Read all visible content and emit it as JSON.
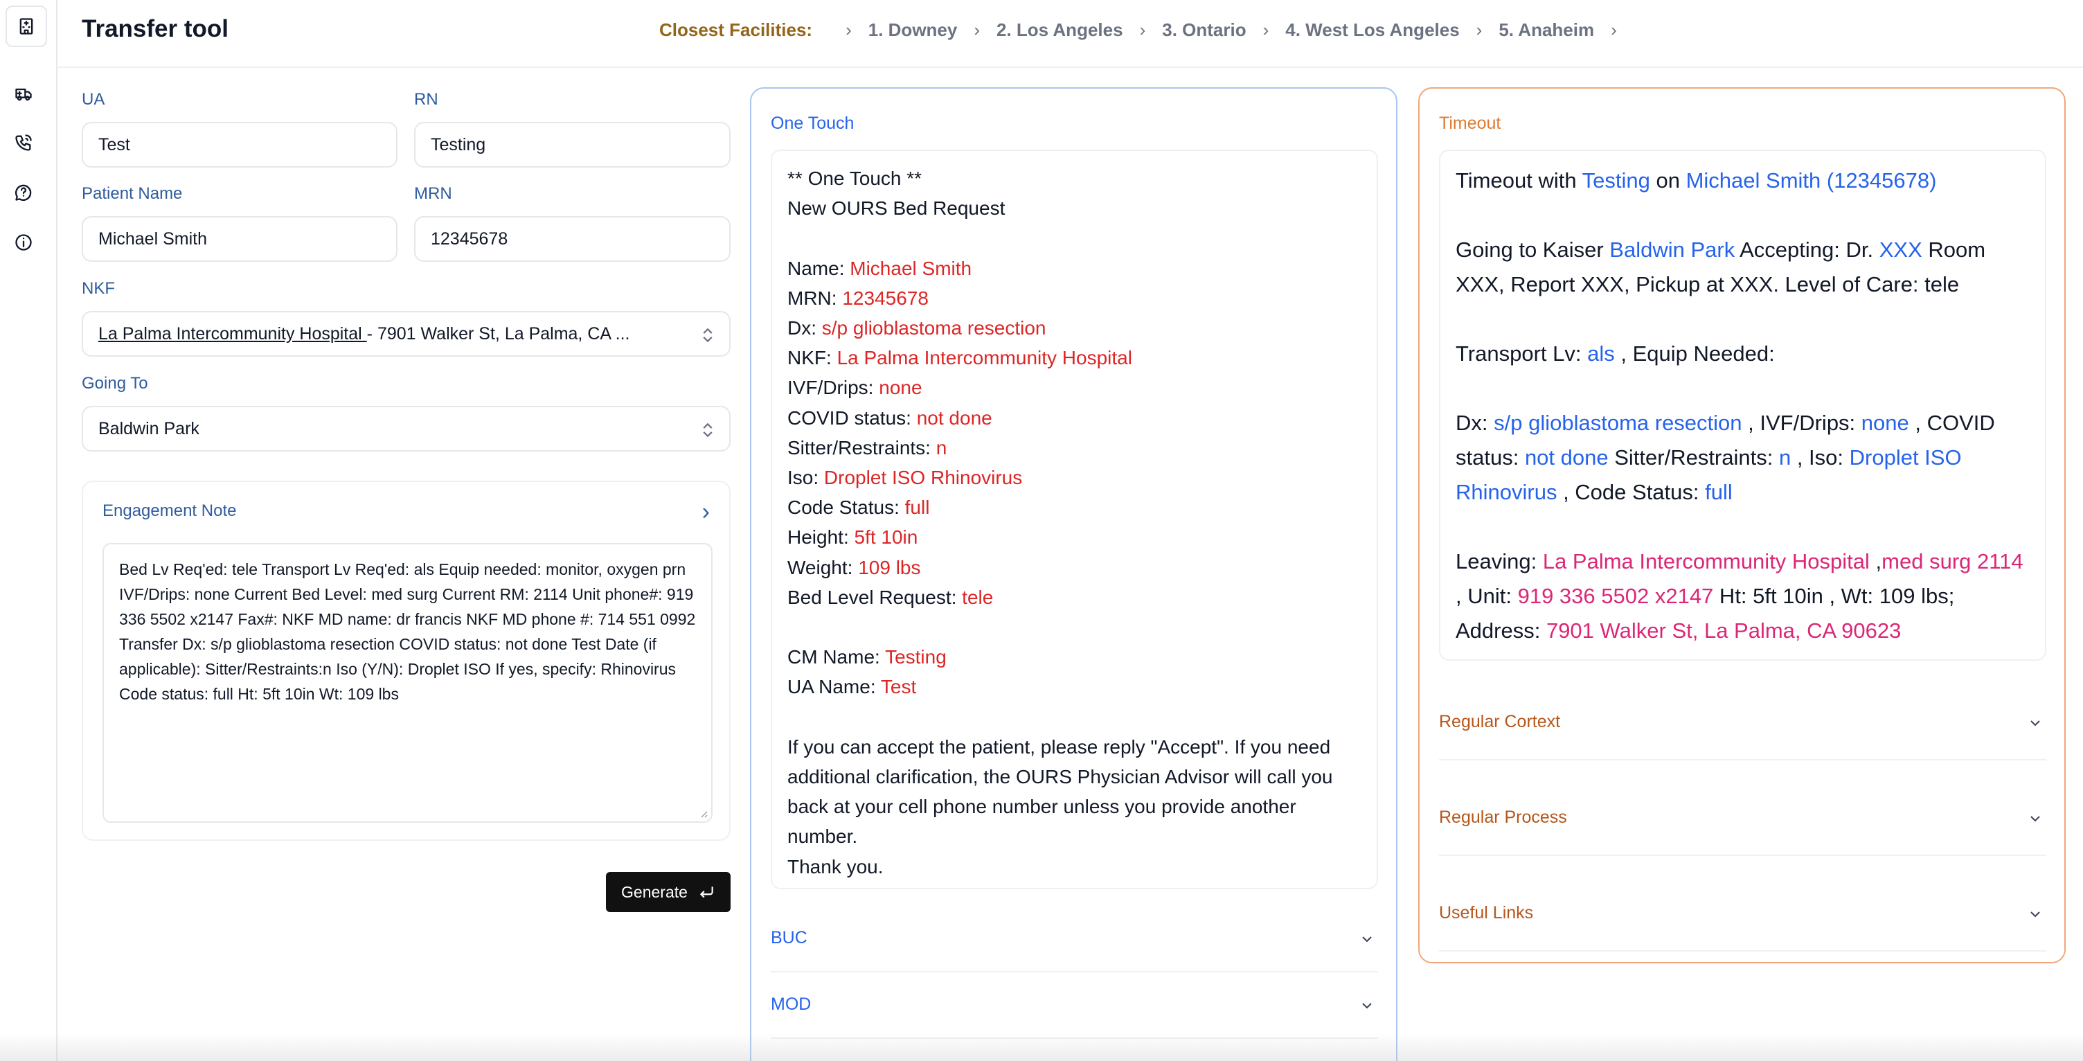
{
  "app": {
    "title": "Transfer tool"
  },
  "breadcrumb": {
    "label": "Closest Facilities:",
    "items": [
      "1.  Downey",
      "2.  Los Angeles",
      "3.  Ontario",
      "4.  West Los Angeles",
      "5.  Anaheim"
    ]
  },
  "sidebar": {
    "icons": [
      "hospital-icon",
      "ambulance-icon",
      "phone-call-icon",
      "help-circle-icon",
      "info-icon"
    ]
  },
  "form": {
    "ua": {
      "label": "UA",
      "value": "Test"
    },
    "rn": {
      "label": "RN",
      "value": "Testing"
    },
    "patient_name": {
      "label": "Patient Name",
      "value": "Michael Smith"
    },
    "mrn": {
      "label": "MRN",
      "value": "12345678"
    },
    "nkf": {
      "label": "NKF",
      "value_link": "La Palma Intercommunity Hospital ",
      "value_rest": "- 7901 Walker St, La Palma, CA ..."
    },
    "going_to": {
      "label": "Going To",
      "value": "Baldwin Park"
    },
    "engagement": {
      "title": "Engagement Note",
      "text": "Bed Lv Req'ed: tele Transport Lv Req'ed: als Equip needed: monitor, oxygen prn IVF/Drips: none Current Bed Level: med surg Current RM: 2114 Unit phone#: 919 336 5502 x2147 Fax#: NKF MD name: dr francis NKF MD phone #: 714 551 0992 Transfer Dx: s/p glioblastoma resection COVID status: not done Test Date (if applicable): Sitter/Restraints:n Iso (Y/N): Droplet ISO If yes, specify: Rhinovirus  Code status: full Ht: 5ft 10in Wt: 109 lbs"
    },
    "generate_label": "Generate"
  },
  "one_touch": {
    "title": "One Touch",
    "header1": "** One Touch **",
    "header2": "New OURS Bed Request",
    "fields": [
      {
        "k": "Name:",
        "v": "Michael Smith"
      },
      {
        "k": "MRN:",
        "v": "12345678"
      },
      {
        "k": "Dx:",
        "v": "s/p glioblastoma resection"
      },
      {
        "k": "NKF:",
        "v": "La Palma Intercommunity Hospital"
      },
      {
        "k": "IVF/Drips:",
        "v": "none"
      },
      {
        "k": "COVID status:",
        "v": "not done"
      },
      {
        "k": "Sitter/Restraints:",
        "v": "n"
      },
      {
        "k": "Iso:",
        "v": "Droplet ISO Rhinovirus"
      },
      {
        "k": "Code Status:",
        "v": "full"
      },
      {
        "k": "Height:",
        "v": "5ft 10in"
      },
      {
        "k": "Weight:",
        "v": "109 lbs"
      },
      {
        "k": "Bed Level Request:",
        "v": "tele"
      }
    ],
    "cm": {
      "k": "CM Name:",
      "v": "Testing"
    },
    "ua": {
      "k": "UA Name:",
      "v": "Test"
    },
    "closing": "If you can accept the patient, please reply \"Accept\". If you need additional clarification, the OURS Physician Advisor will call you back at your cell phone number unless you provide another number.",
    "thanks": "Thank you.",
    "accordions": [
      "BUC",
      "MOD"
    ]
  },
  "timeout": {
    "title": "Timeout",
    "l1": {
      "a": "Timeout with ",
      "rn": "Testing",
      "b": " on ",
      "patient": "Michael Smith (12345678)"
    },
    "l2": {
      "a": "Going to Kaiser ",
      "dest": "Baldwin Park",
      "b": " Accepting: Dr. ",
      "dr": "XXX",
      "c": " Room XXX, Report XXX, Pickup at XXX. Level of Care: tele"
    },
    "l3": {
      "a": "Transport Lv: ",
      "lv": "als",
      "b": " , Equip Needed:"
    },
    "l4": {
      "a": "Dx: ",
      "dx": "s/p glioblastoma resection",
      "b": " , IVF/Drips: ",
      "ivf": "none",
      "c": " , COVID status: ",
      "covid": "not done",
      "d": " Sitter/Restraints: ",
      "sr": "n",
      "e": " , Iso: ",
      "iso": "Droplet ISO Rhinovirus",
      "f": " , Code Status: ",
      "code": "full"
    },
    "l5": {
      "a": "Leaving: ",
      "hosp": "La Palma Intercommunity Hospital",
      "b": " ,",
      "unit_lvl": "med surg 2114",
      "c": " , Unit: ",
      "phone": "919 336 5502 x2147",
      "d": " Ht: 5ft 10in , Wt: 109 lbs; Address: ",
      "addr": "7901 Walker St, La Palma, CA 90623"
    },
    "accordions": [
      "Regular Cortext",
      "Regular Process",
      "Useful Links"
    ]
  },
  "colors": {
    "accent_blue": "#2563eb",
    "red": "#dc2626",
    "pink": "#db2777",
    "orange": "#e07a2f",
    "gold": "#92651a"
  }
}
